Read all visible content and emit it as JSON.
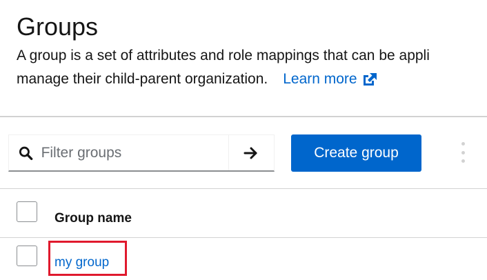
{
  "header": {
    "title": "Groups",
    "description_line1": "A group is a set of attributes and role mappings that can be appli",
    "description_line2": "manage their child-parent organization.",
    "learn_more": "Learn more"
  },
  "toolbar": {
    "search_placeholder": "Filter groups",
    "create_label": "Create group"
  },
  "table": {
    "columns": [
      "Group name"
    ],
    "rows": [
      {
        "name": "my group"
      }
    ]
  },
  "colors": {
    "link": "#0066cc",
    "primary_button": "#0066cc",
    "highlight": "#e0192d"
  },
  "icons": {
    "search": "search-icon",
    "submit": "arrow-right-icon",
    "external": "external-link-icon",
    "kebab": "kebab-menu-icon"
  }
}
